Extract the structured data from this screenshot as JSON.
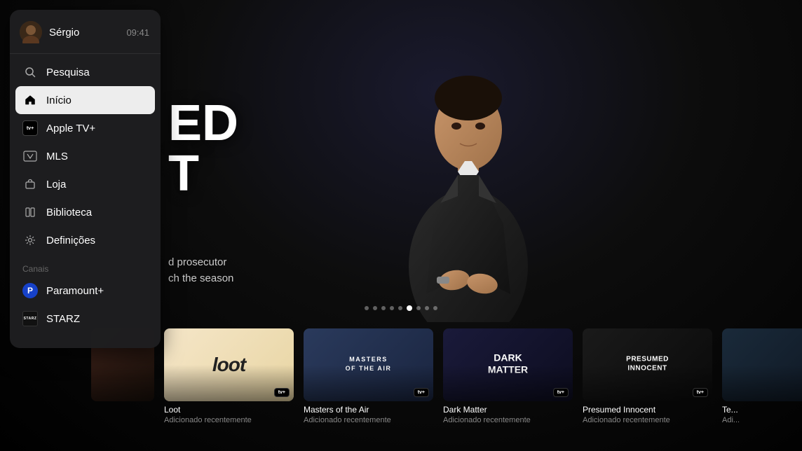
{
  "sidebar": {
    "user": {
      "name": "Sérgio",
      "time": "09:41",
      "avatar_emoji": "👤"
    },
    "nav_items": [
      {
        "id": "search",
        "label": "Pesquisa",
        "icon": "search",
        "active": false
      },
      {
        "id": "home",
        "label": "Início",
        "icon": "home",
        "active": true
      },
      {
        "id": "appletv",
        "label": "Apple TV+",
        "icon": "appletv",
        "active": false
      },
      {
        "id": "mls",
        "label": "MLS",
        "icon": "mls",
        "active": false
      },
      {
        "id": "store",
        "label": "Loja",
        "icon": "bag",
        "active": false
      },
      {
        "id": "library",
        "label": "Biblioteca",
        "icon": "library",
        "active": false
      },
      {
        "id": "settings",
        "label": "Definições",
        "icon": "gear",
        "active": false
      }
    ],
    "section_channels": "Canais",
    "channel_items": [
      {
        "id": "paramount",
        "label": "Paramount+",
        "icon": "paramount"
      },
      {
        "id": "starz",
        "label": "STARZ",
        "icon": "starz"
      }
    ]
  },
  "hero": {
    "title_line1": "ED",
    "title_line2": "T",
    "subtitle_line1": "d prosecutor",
    "subtitle_line2": "ch the season",
    "show_title": "Presumed Innocent"
  },
  "dots": {
    "count": 9,
    "active_index": 5
  },
  "content_row": {
    "label": "Adicionado recentemente",
    "items": [
      {
        "id": "loot",
        "title": "Loot",
        "subtitle": "Adicionado recentemente",
        "thumb_text": "loot",
        "thumb_class": "thumb-loot",
        "badge": "appletv"
      },
      {
        "id": "masters",
        "title": "Masters of the Air",
        "subtitle": "Adicionado recentemente",
        "thumb_text": "MASTERS\nOF THE AIR",
        "thumb_class": "thumb-masters",
        "badge": "appletv"
      },
      {
        "id": "darkmatter",
        "title": "Dark Matter",
        "subtitle": "Adicionado recentemente",
        "thumb_text": "DARK\nMATTER",
        "thumb_class": "thumb-darkmatter",
        "badge": "appletv"
      },
      {
        "id": "presumed",
        "title": "Presumed Innocent",
        "subtitle": "Adicionado recentemente",
        "thumb_text": "PRESUMED\nINNOCENT",
        "thumb_class": "thumb-presumed",
        "badge": "appletv"
      },
      {
        "id": "tech",
        "title": "Te...",
        "subtitle": "Adi...",
        "thumb_text": "",
        "thumb_class": "thumb-tech",
        "badge": "none"
      }
    ]
  }
}
